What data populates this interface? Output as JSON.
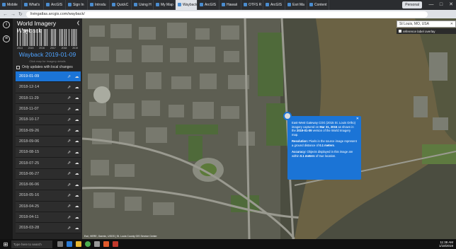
{
  "browser": {
    "tabs": [
      {
        "label": "Mobile "
      },
      {
        "label": "What's "
      },
      {
        "label": "ArcGIS "
      },
      {
        "label": "Sign In"
      },
      {
        "label": "Introdu"
      },
      {
        "label": "QuickC"
      },
      {
        "label": "Using H"
      },
      {
        "label": "My Map"
      },
      {
        "label": "Wayback",
        "active": true
      },
      {
        "label": "ArcGIS "
      },
      {
        "label": "Hawaii"
      },
      {
        "label": "OTFS R"
      },
      {
        "label": "ArcGIS "
      },
      {
        "label": "Esri Ma"
      },
      {
        "label": "Content"
      }
    ],
    "url": "livingatlas.arcgis.com/wayback/",
    "profile": "Personal"
  },
  "sidebar": {
    "title": "World Imagery Wayback",
    "years": [
      "2014",
      "2015",
      "2016",
      "2017",
      "2018",
      "2019"
    ],
    "release_title": "Wayback 2019-01-09",
    "details_hint": "Click map for imagery details",
    "local_changes_label": "Only updates with local changes",
    "releases": [
      "2019-01-09",
      "2018-12-14",
      "2018-11-29",
      "2018-11-07",
      "2018-10-17",
      "2018-09-26",
      "2018-09-06",
      "2018-08-15",
      "2018-07-25",
      "2018-06-27",
      "2018-06-06",
      "2018-05-16",
      "2018-04-25",
      "2018-04-11",
      "2018-03-28"
    ],
    "selected_index": 0
  },
  "map": {
    "search_value": "St Louis, MO, USA",
    "overlay_label": "reference label overlay",
    "attribution": "Esri, HERE, Garmin, USGS | St. Louis County GIS Service Center",
    "popup": {
      "p1_a": "East-West Gateway COG (2015 St. Louis Ortho) imagery captured on ",
      "p1_date": "Mar 31, 2015",
      "p1_b": " as shown in the ",
      "p1_version": "2019-01-09",
      "p1_c": " version of the World Imagery map.",
      "p2_label": "Resolution:",
      "p2_a": " Pixels in the source image represent a ground distance of ",
      "p2_value": "0.1 meters",
      "p2_b": ".",
      "p3_label": "Accuracy:",
      "p3_a": " Objects displayed in this image are within ",
      "p3_value": "0.1 meters",
      "p3_b": " of true location."
    }
  },
  "taskbar": {
    "search_placeholder": "Type here to search",
    "time": "11:38 AM",
    "date": "1/18/2019"
  }
}
